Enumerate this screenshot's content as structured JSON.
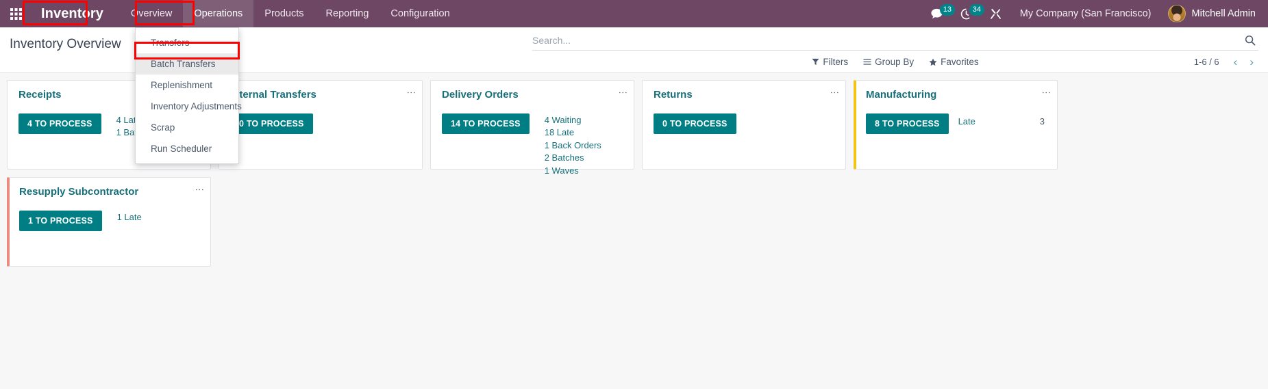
{
  "navbar": {
    "apps_icon": "apps-grid-icon",
    "brand": "Inventory",
    "menu": [
      {
        "label": "Overview",
        "active": false
      },
      {
        "label": "Operations",
        "active": true
      },
      {
        "label": "Products",
        "active": false
      },
      {
        "label": "Reporting",
        "active": false
      },
      {
        "label": "Configuration",
        "active": false
      }
    ],
    "systray": {
      "messages_badge": "13",
      "activities_badge": "34",
      "company": "My Company (San Francisco)",
      "user": "Mitchell Admin"
    }
  },
  "dropdown": {
    "open_for": "Operations",
    "items": [
      {
        "label": "Transfers",
        "highlighted": false
      },
      {
        "label": "Batch Transfers",
        "highlighted": true
      },
      {
        "label": "Replenishment",
        "highlighted": false
      },
      {
        "label": "Inventory Adjustments",
        "highlighted": false
      },
      {
        "label": "Scrap",
        "highlighted": false
      },
      {
        "label": "Run Scheduler",
        "highlighted": false
      }
    ]
  },
  "control_panel": {
    "title": "Inventory Overview",
    "search_placeholder": "Search...",
    "filters": [
      {
        "label": "Filters",
        "icon": "funnel-icon"
      },
      {
        "label": "Group By",
        "icon": "bars-icon"
      },
      {
        "label": "Favorites",
        "icon": "star-icon"
      }
    ],
    "pager": {
      "range": "1-6 / 6",
      "prev": "‹",
      "next": "›"
    }
  },
  "cards": [
    {
      "title": "Receipts",
      "button": "4 TO PROCESS",
      "accent": "none",
      "stats": [
        "4 Late",
        "1 Batches"
      ],
      "stat_rows": []
    },
    {
      "title": "Internal Transfers",
      "button": "0 TO PROCESS",
      "accent": "none",
      "stats": [],
      "stat_rows": []
    },
    {
      "title": "Delivery Orders",
      "button": "14 TO PROCESS",
      "accent": "none",
      "stats": [
        "4 Waiting",
        "18 Late",
        "1 Back Orders",
        "2 Batches",
        "1 Waves"
      ],
      "stat_rows": []
    },
    {
      "title": "Returns",
      "button": "0 TO PROCESS",
      "accent": "none",
      "stats": [],
      "stat_rows": []
    },
    {
      "title": "Manufacturing",
      "button": "8 TO PROCESS",
      "accent": "yellow",
      "stats": [],
      "stat_rows": [
        {
          "label": "Late",
          "value": "3"
        }
      ]
    },
    {
      "title": "Resupply Subcontractor",
      "button": "1 TO PROCESS",
      "accent": "red",
      "stats": [
        "1 Late"
      ],
      "stat_rows": []
    }
  ],
  "colors": {
    "navbar_bg": "#6d4764",
    "accent_teal": "#017e84",
    "card_title": "#16707a",
    "highlight_red": "#ff0000",
    "accent_yellow": "#f0c419",
    "accent_salmon": "#eb8a7f"
  }
}
